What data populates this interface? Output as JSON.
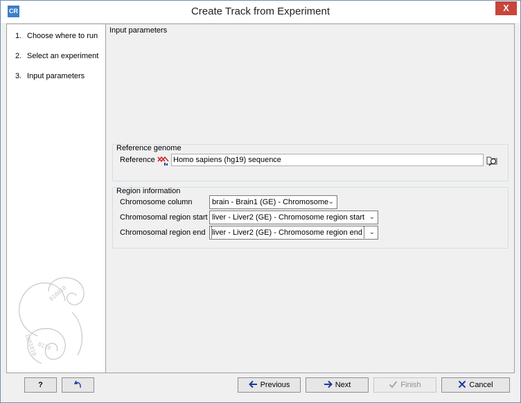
{
  "window": {
    "app_icon": "CR",
    "title": "Create Track from Experiment",
    "close_label": "X"
  },
  "steps": [
    {
      "num": "1.",
      "label": "Choose where to run"
    },
    {
      "num": "2.",
      "label": "Select an experiment"
    },
    {
      "num": "3.",
      "label": "Input parameters"
    }
  ],
  "content": {
    "title": "Input parameters",
    "reference_genome": {
      "group_title": "Reference genome",
      "reference_label": "Reference",
      "reference_value": "Homo sapiens (hg19) sequence"
    },
    "region_information": {
      "group_title": "Region information",
      "chromosome_column_label": "Chromosome column",
      "chromosome_column_value": "brain - Brain1 (GE) - Chromosome",
      "region_start_label": "Chromosomal region start",
      "region_start_value": "liver - Liver2 (GE) - Chromosome region start",
      "region_end_label": "Chromosomal region end",
      "region_end_value": "liver - Liver2 (GE) - Chromosome region end"
    }
  },
  "footer": {
    "help_label": "?",
    "previous_label": "Previous",
    "next_label": "Next",
    "finish_label": "Finish",
    "cancel_label": "Cancel"
  },
  "icons": {
    "app": "app-logo-icon",
    "close": "close-icon",
    "sequence": "sequence-icon",
    "browse": "browse-folder-icon",
    "chevron": "chevron-down-icon",
    "reset": "reset-arrow-icon",
    "previous": "arrow-left-icon",
    "next": "arrow-right-icon",
    "finish": "check-icon",
    "cancel": "x-icon"
  },
  "colors": {
    "close_button": "#c7463a",
    "app_icon": "#3c7fc8",
    "sequence_icon": "#d02020",
    "arrow_icon": "#1a3aa0"
  }
}
